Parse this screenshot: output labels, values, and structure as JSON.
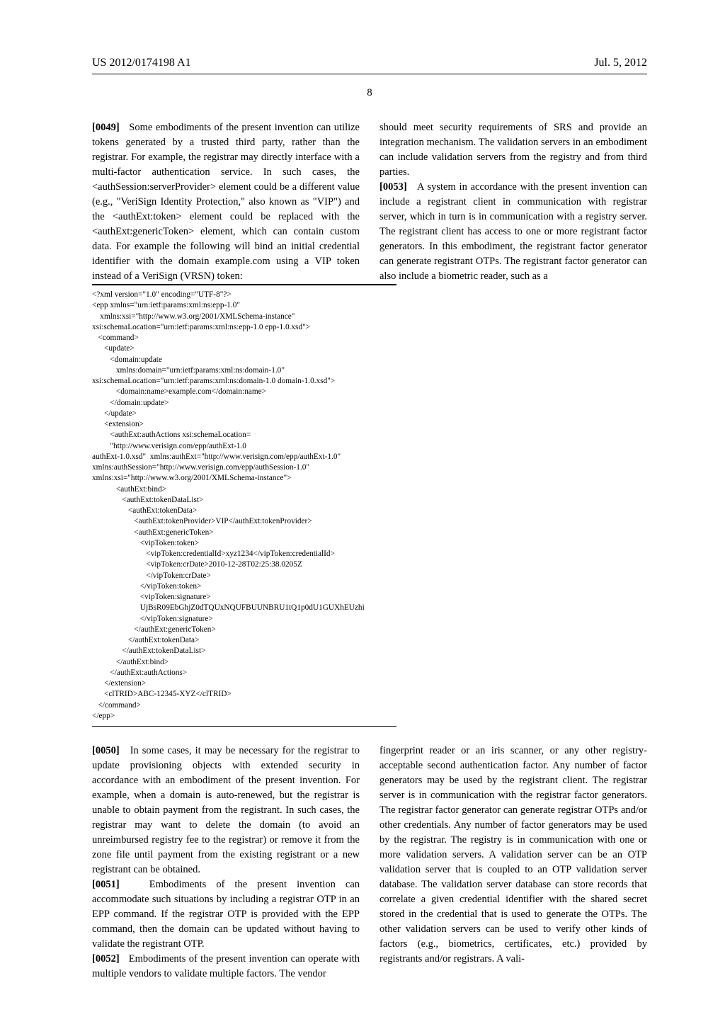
{
  "header": {
    "pub_number": "US 2012/0174198 A1",
    "pub_date": "Jul. 5, 2012"
  },
  "page_number": "8",
  "top_left_col": {
    "p49_num": "[0049]",
    "p49_text": "   Some embodiments of the present invention can utilize tokens generated by a trusted third party, rather than the registrar. For example, the registrar may directly interface with a multi-factor authentication service. In such cases, the <authSession:serverProvider> element could be a different value (e.g., \"VeriSign Identity Protection,\" also known as \"VIP\") and the <authExt:token> element could be replaced with the <authExt:genericToken> element, which can contain custom data. For example the following will bind an initial credential identifier with the domain example.com using a VIP token instead of a VeriSign (VRSN) token:"
  },
  "top_right_col": {
    "p52_cont": "should meet security requirements of SRS and provide an integration mechanism. The validation servers in an embodiment can include validation servers from the registry and from third parties.",
    "p53_num": "[0053]",
    "p53_text": "   A system in accordance with the present invention can include a registrant client in communication with registrar server, which in turn is in communication with a registry server. The registrant client has access to one or more registrant factor generators. In this embodiment, the registrant factor generator can generate registrant OTPs. The registrant factor generator can also include a biometric reader, such as a"
  },
  "code": "<?xml version=\"1.0\" encoding=\"UTF-8\"?>\n<epp xmlns=\"urn:ietf:params:xml:ns:epp-1.0\"\n    xmlns:xsi=\"http://www.w3.org/2001/XMLSchema-instance\"\nxsi:schemaLocation=\"urn:ietf:params:xml:ns:epp-1.0 epp-1.0.xsd\">\n   <command>\n      <update>\n         <domain:update\n            xmlns:domain=\"urn:ietf:params:xml:ns:domain-1.0\"\nxsi:schemaLocation=\"urn:ietf:params:xml:ns:domain-1.0 domain-1.0.xsd\">\n            <domain:name>example.com</domain:name>\n         </domain:update>\n      </update>\n      <extension>\n         <authExt:authActions xsi:schemaLocation=\n         \"http://www.verisign.com/epp/authExt-1.0\nauthExt-1.0.xsd\"  xmlns:authExt=\"http://www.verisign.com/epp/authExt-1.0\"\nxmlns:authSession=\"http://www.verisign.com/epp/authSession-1.0\"\nxmlns:xsi=\"http://www.w3.org/2001/XMLSchema-instance\">\n            <authExt:bind>\n               <authExt:tokenDataList>\n                  <authExt:tokenData>\n                     <authExt:tokenProvider>VIP</authExt:tokenProvider>\n                     <authExt:genericToken>\n                        <vipToken:token>\n                           <vipToken:credentialId>xyz1234</vipToken:credentialId>\n                           <vipToken:crDate>2010-12-28T02:25:38.0205Z\n                           </vipToken:crDate>\n                        </vipToken:token>\n                        <vipToken:signature>\n                        UjBsR09EbGhjZ0dTQUxNQUFBUUNBRU1tQ1p0dU1GUXhEUzhi\n                        </vipToken:signature>\n                     </authExt:genericToken>\n                  </authExt:tokenData>\n               </authExt:tokenDataList>\n            </authExt:bind>\n         </authExt:authActions>\n      </extension>\n      <clTRID>ABC-12345-XYZ</clTRID>\n   </command>\n</epp>",
  "bottom_left_col": {
    "p50_num": "[0050]",
    "p50_text": "   In some cases, it may be necessary for the registrar to update provisioning objects with extended security in accordance with an embodiment of the present invention. For example, when a domain is auto-renewed, but the registrar is unable to obtain payment from the registrant. In such cases, the registrar may want to delete the domain (to avoid an unreimbursed registry fee to the registrar) or remove it from the zone file until payment from the existing registrant or a new registrant can be obtained.",
    "p51_num": "[0051]",
    "p51_text": "   Embodiments of the present invention can accommodate such situations by including a registrar OTP in an EPP command. If the registrar OTP is provided with the EPP command, then the domain can be updated without having to validate the registrant OTP.",
    "p52_num": "[0052]",
    "p52_text": "   Embodiments of the present invention can operate with multiple vendors to validate multiple factors. The vendor"
  },
  "bottom_right_col": {
    "p53_cont": "fingerprint reader or an iris scanner, or any other registry-acceptable second authentication factor. Any number of factor generators may be used by the registrant client. The registrar server is in communication with the registrar factor generators. The registrar factor generator can generate registrar OTPs and/or other credentials. Any number of factor generators may be used by the registrar. The registry is in communication with one or more validation servers. A validation server can be an OTP validation server that is coupled to an OTP validation server database. The validation server database can store records that correlate a given credential identifier with the shared secret stored in the credential that is used to generate the OTPs. The other validation servers can be used to verify other kinds of factors (e.g., biometrics, certificates, etc.) provided by registrants and/or registrars. A vali-"
  }
}
